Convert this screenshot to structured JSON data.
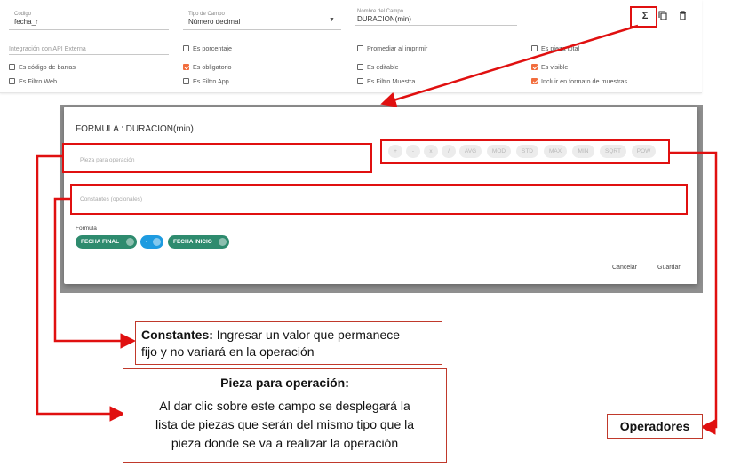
{
  "form": {
    "codigo": {
      "label": "Código",
      "value": "fecha_r"
    },
    "tipo": {
      "label": "Tipo de Campo",
      "value": "Número decimal"
    },
    "nombre": {
      "label": "Nombre del Campo",
      "value": "DURACION(min)"
    },
    "integracion_placeholder": "Integración con API Externa",
    "checkboxes": [
      {
        "label": "Es porcentaje",
        "checked": false
      },
      {
        "label": "Promediar al imprimir",
        "checked": false
      },
      {
        "label": "Es pieza total",
        "checked": false
      },
      {
        "label": "Es código de barras",
        "checked": false
      },
      {
        "label": "Es obligatorio",
        "checked": true
      },
      {
        "label": "Es editable",
        "checked": false
      },
      {
        "label": "Es visible",
        "checked": true
      },
      {
        "label": "Es Filtro Web",
        "checked": false
      },
      {
        "label": "Es Filtro App",
        "checked": false
      },
      {
        "label": "Es Filtro Muestra",
        "checked": false
      },
      {
        "label": "Incluir en formato de muestras",
        "checked": true
      }
    ],
    "toolbar": {
      "sigma": "Σ",
      "sigma_icon": "sigma-icon",
      "copy_icon": "copy-icon",
      "delete_icon": "delete-icon"
    }
  },
  "dialog": {
    "title": "FORMULA : DURACION(min)",
    "pieza_placeholder": "Pieza para operación",
    "constantes_placeholder": "Constantes (opcionales)",
    "operators": [
      "+",
      "-",
      "x",
      "/",
      "AVG",
      "MOD",
      "STD",
      "MAX",
      "MIN",
      "SQRT",
      "POW"
    ],
    "formula_label": "Formula",
    "formula_chips": [
      {
        "label": "FECHA FINAL",
        "color": "#2e8b6e"
      },
      {
        "label": "-",
        "color": "#1e9be0"
      },
      {
        "label": "FECHA INICIO",
        "color": "#2e8b6e"
      }
    ],
    "cancel": "Cancelar",
    "save": "Guardar"
  },
  "callouts": {
    "constantes_title": "Constantes:",
    "constantes_text1": " Ingresar un valor que permanece",
    "constantes_text2": "fijo y no variará en la operación",
    "pieza_title": "Pieza para operación:",
    "pieza_line1": "Al dar clic sobre este campo se desplegará la",
    "pieza_line2": "lista de piezas que serán del mismo tipo que la",
    "pieza_line3": "pieza donde se va a realizar la operación",
    "operadores": "Operadores"
  },
  "colors": {
    "accent_red": "#e01010",
    "checkbox_orange": "#f26d3d",
    "chip_green": "#2e8b6e",
    "chip_blue": "#1e9be0"
  }
}
